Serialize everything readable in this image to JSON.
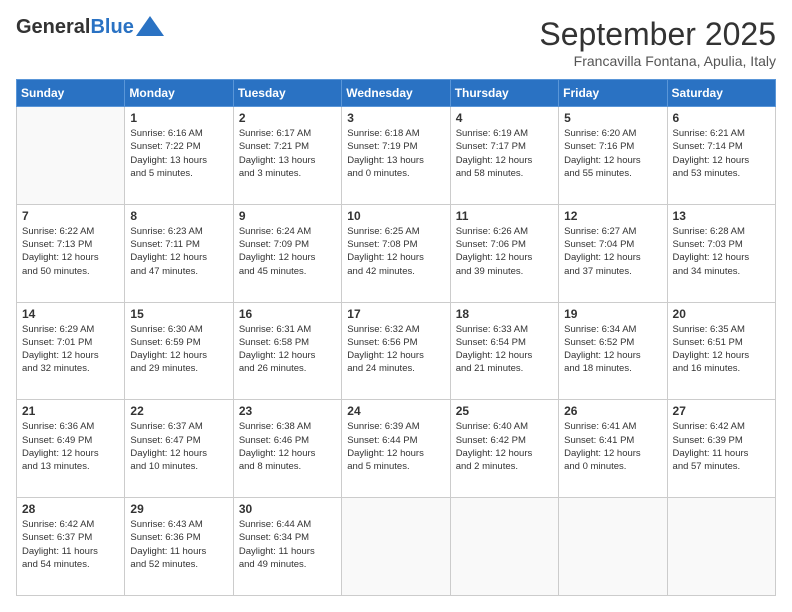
{
  "header": {
    "logo_general": "General",
    "logo_blue": "Blue",
    "month_title": "September 2025",
    "subtitle": "Francavilla Fontana, Apulia, Italy"
  },
  "weekdays": [
    "Sunday",
    "Monday",
    "Tuesday",
    "Wednesday",
    "Thursday",
    "Friday",
    "Saturday"
  ],
  "weeks": [
    [
      {
        "day": "",
        "info": ""
      },
      {
        "day": "1",
        "info": "Sunrise: 6:16 AM\nSunset: 7:22 PM\nDaylight: 13 hours\nand 5 minutes."
      },
      {
        "day": "2",
        "info": "Sunrise: 6:17 AM\nSunset: 7:21 PM\nDaylight: 13 hours\nand 3 minutes."
      },
      {
        "day": "3",
        "info": "Sunrise: 6:18 AM\nSunset: 7:19 PM\nDaylight: 13 hours\nand 0 minutes."
      },
      {
        "day": "4",
        "info": "Sunrise: 6:19 AM\nSunset: 7:17 PM\nDaylight: 12 hours\nand 58 minutes."
      },
      {
        "day": "5",
        "info": "Sunrise: 6:20 AM\nSunset: 7:16 PM\nDaylight: 12 hours\nand 55 minutes."
      },
      {
        "day": "6",
        "info": "Sunrise: 6:21 AM\nSunset: 7:14 PM\nDaylight: 12 hours\nand 53 minutes."
      }
    ],
    [
      {
        "day": "7",
        "info": "Sunrise: 6:22 AM\nSunset: 7:13 PM\nDaylight: 12 hours\nand 50 minutes."
      },
      {
        "day": "8",
        "info": "Sunrise: 6:23 AM\nSunset: 7:11 PM\nDaylight: 12 hours\nand 47 minutes."
      },
      {
        "day": "9",
        "info": "Sunrise: 6:24 AM\nSunset: 7:09 PM\nDaylight: 12 hours\nand 45 minutes."
      },
      {
        "day": "10",
        "info": "Sunrise: 6:25 AM\nSunset: 7:08 PM\nDaylight: 12 hours\nand 42 minutes."
      },
      {
        "day": "11",
        "info": "Sunrise: 6:26 AM\nSunset: 7:06 PM\nDaylight: 12 hours\nand 39 minutes."
      },
      {
        "day": "12",
        "info": "Sunrise: 6:27 AM\nSunset: 7:04 PM\nDaylight: 12 hours\nand 37 minutes."
      },
      {
        "day": "13",
        "info": "Sunrise: 6:28 AM\nSunset: 7:03 PM\nDaylight: 12 hours\nand 34 minutes."
      }
    ],
    [
      {
        "day": "14",
        "info": "Sunrise: 6:29 AM\nSunset: 7:01 PM\nDaylight: 12 hours\nand 32 minutes."
      },
      {
        "day": "15",
        "info": "Sunrise: 6:30 AM\nSunset: 6:59 PM\nDaylight: 12 hours\nand 29 minutes."
      },
      {
        "day": "16",
        "info": "Sunrise: 6:31 AM\nSunset: 6:58 PM\nDaylight: 12 hours\nand 26 minutes."
      },
      {
        "day": "17",
        "info": "Sunrise: 6:32 AM\nSunset: 6:56 PM\nDaylight: 12 hours\nand 24 minutes."
      },
      {
        "day": "18",
        "info": "Sunrise: 6:33 AM\nSunset: 6:54 PM\nDaylight: 12 hours\nand 21 minutes."
      },
      {
        "day": "19",
        "info": "Sunrise: 6:34 AM\nSunset: 6:52 PM\nDaylight: 12 hours\nand 18 minutes."
      },
      {
        "day": "20",
        "info": "Sunrise: 6:35 AM\nSunset: 6:51 PM\nDaylight: 12 hours\nand 16 minutes."
      }
    ],
    [
      {
        "day": "21",
        "info": "Sunrise: 6:36 AM\nSunset: 6:49 PM\nDaylight: 12 hours\nand 13 minutes."
      },
      {
        "day": "22",
        "info": "Sunrise: 6:37 AM\nSunset: 6:47 PM\nDaylight: 12 hours\nand 10 minutes."
      },
      {
        "day": "23",
        "info": "Sunrise: 6:38 AM\nSunset: 6:46 PM\nDaylight: 12 hours\nand 8 minutes."
      },
      {
        "day": "24",
        "info": "Sunrise: 6:39 AM\nSunset: 6:44 PM\nDaylight: 12 hours\nand 5 minutes."
      },
      {
        "day": "25",
        "info": "Sunrise: 6:40 AM\nSunset: 6:42 PM\nDaylight: 12 hours\nand 2 minutes."
      },
      {
        "day": "26",
        "info": "Sunrise: 6:41 AM\nSunset: 6:41 PM\nDaylight: 12 hours\nand 0 minutes."
      },
      {
        "day": "27",
        "info": "Sunrise: 6:42 AM\nSunset: 6:39 PM\nDaylight: 11 hours\nand 57 minutes."
      }
    ],
    [
      {
        "day": "28",
        "info": "Sunrise: 6:42 AM\nSunset: 6:37 PM\nDaylight: 11 hours\nand 54 minutes."
      },
      {
        "day": "29",
        "info": "Sunrise: 6:43 AM\nSunset: 6:36 PM\nDaylight: 11 hours\nand 52 minutes."
      },
      {
        "day": "30",
        "info": "Sunrise: 6:44 AM\nSunset: 6:34 PM\nDaylight: 11 hours\nand 49 minutes."
      },
      {
        "day": "",
        "info": ""
      },
      {
        "day": "",
        "info": ""
      },
      {
        "day": "",
        "info": ""
      },
      {
        "day": "",
        "info": ""
      }
    ]
  ]
}
